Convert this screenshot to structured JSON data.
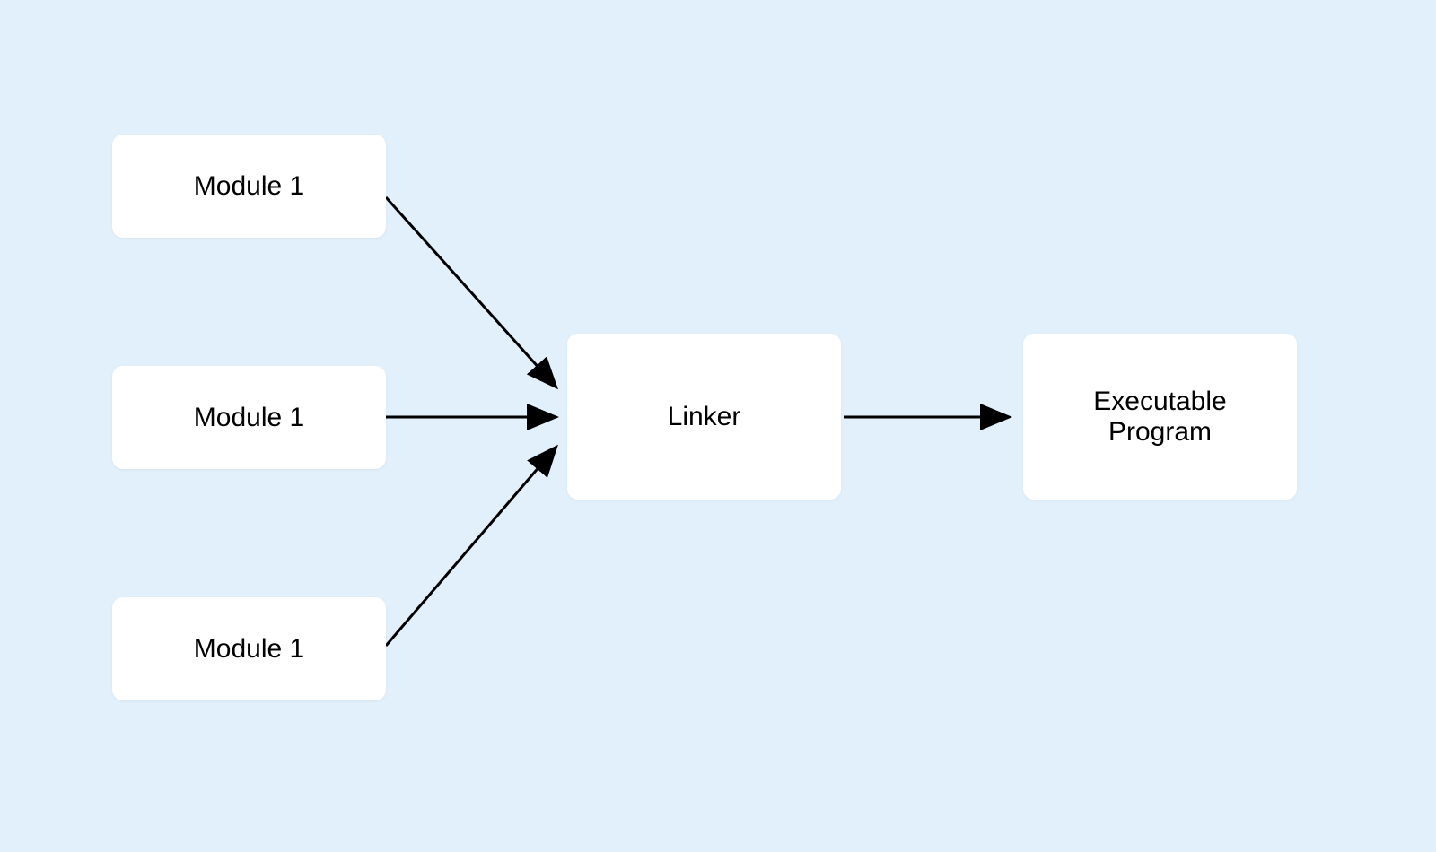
{
  "diagram": {
    "nodes": {
      "module1": {
        "label": "Module 1"
      },
      "module2": {
        "label": "Module 1"
      },
      "module3": {
        "label": "Module 1"
      },
      "linker": {
        "label": "Linker"
      },
      "executable": {
        "label": "Executable Program"
      }
    },
    "colors": {
      "background": "#e2f0fc",
      "nodeBackground": "#ffffff",
      "text": "#000000",
      "arrow": "#000000"
    }
  }
}
